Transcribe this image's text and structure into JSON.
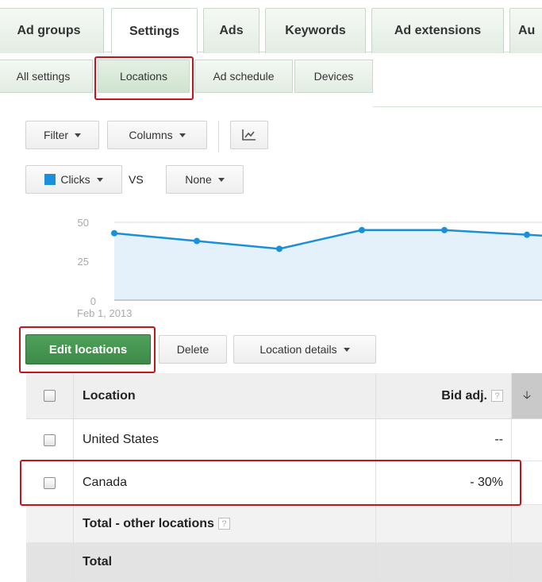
{
  "tabs": [
    {
      "label": "Ad groups"
    },
    {
      "label": "Settings",
      "active": true
    },
    {
      "label": "Ads"
    },
    {
      "label": "Keywords"
    },
    {
      "label": "Ad extensions"
    },
    {
      "label": "Au"
    }
  ],
  "subtabs": [
    {
      "label": "All settings"
    },
    {
      "label": "Locations",
      "active": true
    },
    {
      "label": "Ad schedule"
    },
    {
      "label": "Devices"
    }
  ],
  "toolbar": {
    "filter_label": "Filter",
    "columns_label": "Columns",
    "chart_toggle_icon": "line-chart-icon"
  },
  "metric_selector": {
    "metric1_label": "Clicks",
    "metric1_color": "#1c8fd9",
    "vs_label": "VS",
    "metric2_label": "None"
  },
  "chart_data": {
    "type": "area",
    "series": [
      {
        "values": [
          43,
          38,
          33,
          45,
          45,
          42
        ]
      }
    ],
    "y_ticks": [
      "50",
      "25",
      "0"
    ],
    "ylim": [
      0,
      50
    ],
    "x_start_label": "Feb 1, 2013",
    "color": "#1c8fd9",
    "fill": "#e4f1fa",
    "grid": true
  },
  "actions": {
    "edit_locations_label": "Edit locations",
    "delete_label": "Delete",
    "location_details_label": "Location details"
  },
  "table": {
    "columns": {
      "location": "Location",
      "bid_adj": "Bid adj.",
      "help_glyph": "?",
      "sort_glyph": "🡣"
    },
    "rows": [
      {
        "location": "United States",
        "bid_adj": "--"
      },
      {
        "location": "Canada",
        "bid_adj": "- 30%"
      }
    ],
    "total_other_label": "Total - other locations",
    "total_label": "Total"
  },
  "highlight_color": "#c0161b"
}
